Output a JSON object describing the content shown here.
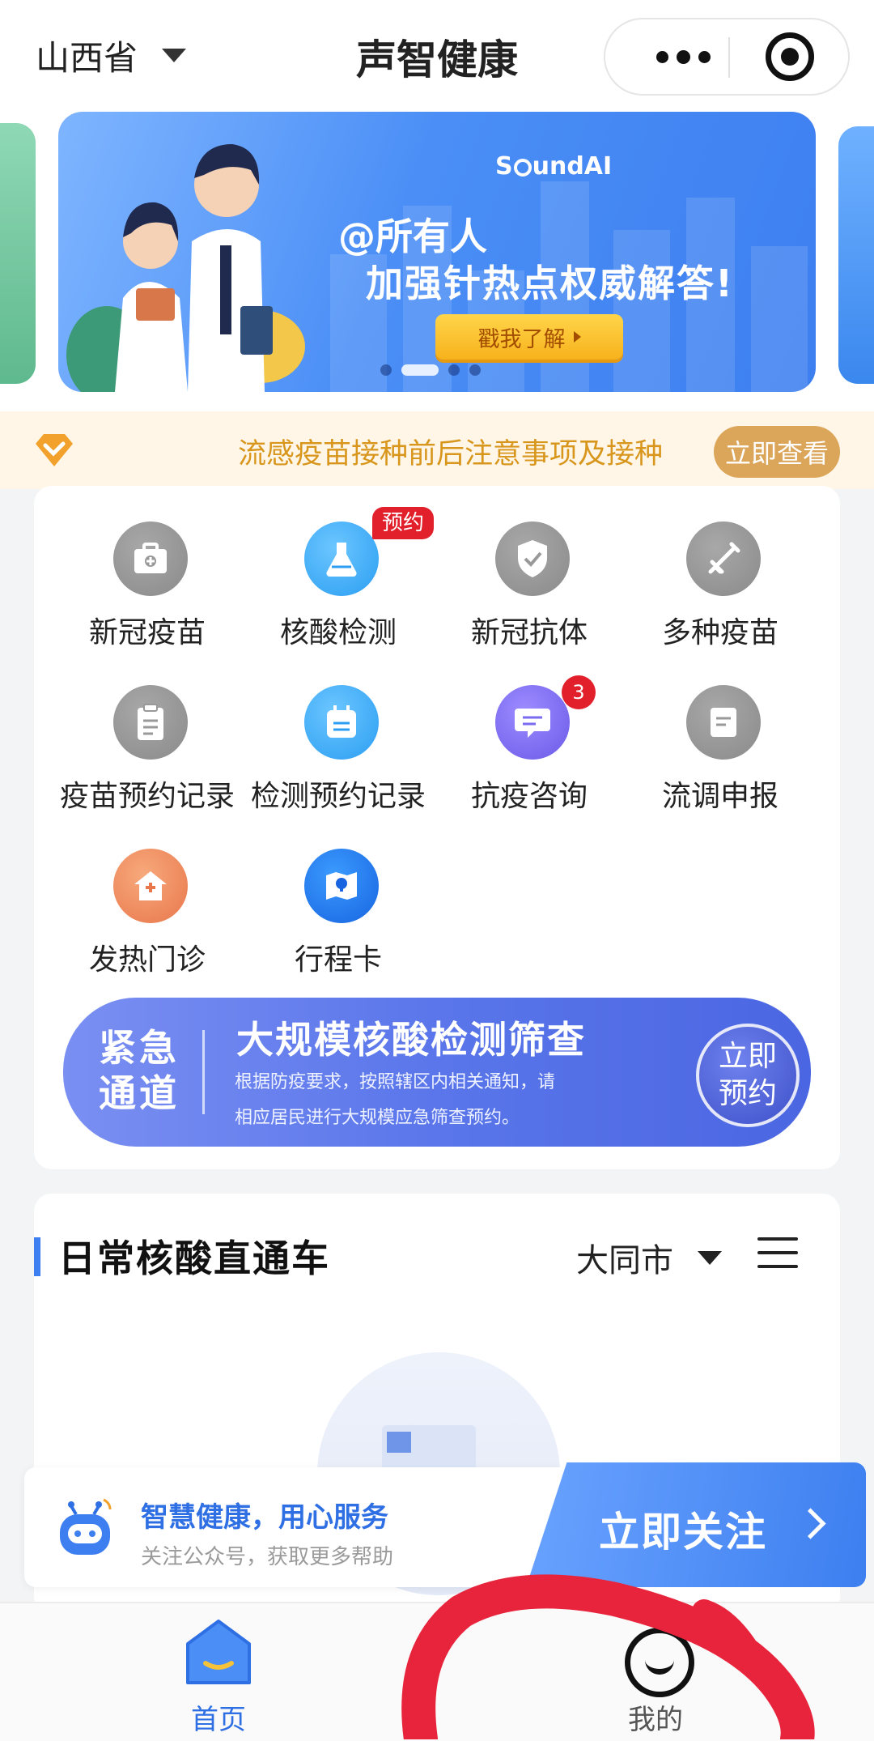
{
  "header": {
    "region": "山西省",
    "title": "声智健康",
    "more_icon": "more-dots-icon",
    "close_icon": "target-circle-icon"
  },
  "banner": {
    "brand": "SoundAI",
    "brand_pre": "S",
    "brand_post": "undAI",
    "headline1": "@所有人",
    "headline2": "加强针热点权威解答!",
    "cta": "戳我了解",
    "slide_count": 4,
    "active_slide": 2
  },
  "notice": {
    "text": "流感疫苗接种前后注意事项及接种",
    "button": "立即查看",
    "icon": "diamond-check-icon"
  },
  "services": [
    {
      "label": "新冠疫苗",
      "icon": "medkit-icon",
      "color": "gray"
    },
    {
      "label": "核酸检测",
      "icon": "flask-icon",
      "color": "blue",
      "tag": "预约"
    },
    {
      "label": "新冠抗体",
      "icon": "shield-check-icon",
      "color": "gray"
    },
    {
      "label": "多种疫苗",
      "icon": "syringe-icon",
      "color": "gray"
    },
    {
      "label": "疫苗预约记录",
      "icon": "clipboard-icon",
      "color": "gray"
    },
    {
      "label": "检测预约记录",
      "icon": "calendar-icon",
      "color": "blue"
    },
    {
      "label": "抗疫咨询",
      "icon": "chat-icon",
      "color": "purple",
      "badge": "3"
    },
    {
      "label": "流调申报",
      "icon": "document-icon",
      "color": "gray"
    },
    {
      "label": "发热门诊",
      "icon": "clinic-icon",
      "color": "orange"
    },
    {
      "label": "行程卡",
      "icon": "map-pin-icon",
      "color": "deepblue"
    }
  ],
  "emergency": {
    "tag": "紧急通道",
    "tag_line1": "紧急",
    "tag_line2": "通道",
    "title": "大规模核酸检测筛查",
    "desc1": "根据防疫要求，按照辖区内相关通知，请",
    "desc2": "相应居民进行大规模应急筛查预约。",
    "button": "立即预约",
    "button_line1": "立即",
    "button_line2": "预约"
  },
  "daily": {
    "title": "日常核酸直通车",
    "city": "大同市",
    "list_icon": "list-menu-icon"
  },
  "follow": {
    "title": "智慧健康，用心服务",
    "subtitle": "关注公众号，获取更多帮助",
    "button": "立即关注",
    "robot_icon": "robot-icon"
  },
  "tabbar": {
    "items": [
      {
        "label": "首页",
        "icon": "home-icon",
        "active": true
      },
      {
        "label": "我的",
        "icon": "smiley-icon",
        "active": false
      }
    ]
  },
  "colors": {
    "primary": "#3d7ff0",
    "badge": "#e2202c",
    "notice_text": "#d8961c",
    "notice_button": "#dba55a",
    "annotation_red": "#e8243c"
  }
}
